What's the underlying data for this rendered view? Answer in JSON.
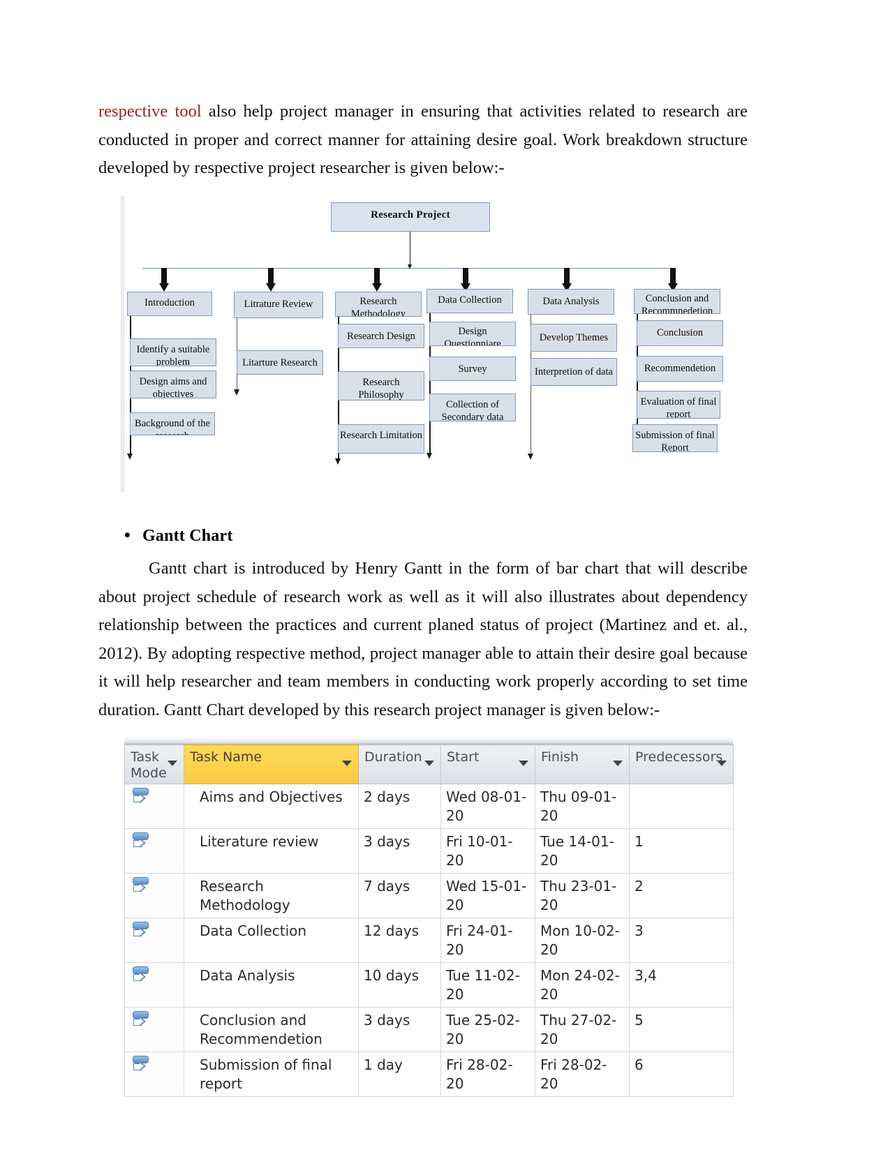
{
  "document": {
    "paragraph1_lead": "respective tool",
    "paragraph1_rest": " also help project manager in ensuring that activities related to research are conducted in proper and correct manner for attaining desire goal. Work breakdown structure developed by respective project researcher is given below:-",
    "bullet_marker": "•",
    "bullet_heading": "Gantt Chart",
    "paragraph2": "Gantt chart is introduced by Henry Gantt in the form of bar chart that will describe about project schedule of research work as well as it will also illustrates about dependency relationship between the practices and current planed status of project (Martinez and et. al., 2012). By adopting respective method, project manager able to attain their desire goal because it will help researcher and team members in conducting work properly according to set time duration. Gantt Chart developed by this research project manager is given below:-"
  },
  "wbs": {
    "root": "Research Project",
    "branches": [
      {
        "title": "Introduction",
        "children": [
          "Identify a suitable problem",
          "Design aims and objectives",
          "Background of the research"
        ]
      },
      {
        "title": "Litrature Review",
        "children": [
          "Litarture Research"
        ]
      },
      {
        "title": "Research Methodology",
        "children": [
          "Research Design",
          "Research Philosophy",
          "Research Limitation"
        ]
      },
      {
        "title": "Data Collection",
        "children": [
          "Design Questionniare",
          "Survey",
          "Collection of Secondary data"
        ]
      },
      {
        "title": "Data Analysis",
        "children": [
          "Develop Themes",
          "Interpretion of data"
        ]
      },
      {
        "title": "Conclusion and Recommnedetion",
        "children": [
          "Conclusion",
          "Recommendetion",
          "Evaluation of final report",
          "Submission of final Report"
        ]
      }
    ],
    "colors": {
      "box_fill": "#d9dfe9",
      "box_border": "#7f9ab8",
      "connector": "#1b1b1b"
    }
  },
  "gantt_table": {
    "columns": [
      "Task Mode",
      "Task Name",
      "Duration",
      "Start",
      "Finish",
      "Predecessors"
    ],
    "highlighted_column": "Task Name",
    "highlight_color": "#fcd34d",
    "filter_icon": "chevron-down-icon",
    "mode_icon": "auto-scheduled-icon",
    "rows": [
      {
        "mode": "",
        "name": "Aims and Objectives",
        "duration": "2 days",
        "start": "Wed 08-01-20",
        "finish": "Thu 09-01-20",
        "predecessors": ""
      },
      {
        "mode": "",
        "name": "Literature review",
        "duration": "3 days",
        "start": "Fri 10-01-20",
        "finish": "Tue 14-01-20",
        "predecessors": "1"
      },
      {
        "mode": "",
        "name": "Research Methodology",
        "duration": "7 days",
        "start": "Wed 15-01-20",
        "finish": "Thu 23-01-20",
        "predecessors": "2"
      },
      {
        "mode": "",
        "name": "Data Collection",
        "duration": "12 days",
        "start": "Fri 24-01-20",
        "finish": "Mon 10-02-20",
        "predecessors": "3"
      },
      {
        "mode": "",
        "name": "Data Analysis",
        "duration": "10 days",
        "start": "Tue 11-02-20",
        "finish": "Mon 24-02-20",
        "predecessors": "3,4"
      },
      {
        "mode": "",
        "name": "Conclusion and Recommendetion",
        "duration": "3 days",
        "start": "Tue 25-02-20",
        "finish": "Thu 27-02-20",
        "predecessors": "5"
      },
      {
        "mode": "",
        "name": "Submission of final report",
        "duration": "1 day",
        "start": "Fri 28-02-20",
        "finish": "Fri 28-02-20",
        "predecessors": "6"
      }
    ]
  }
}
